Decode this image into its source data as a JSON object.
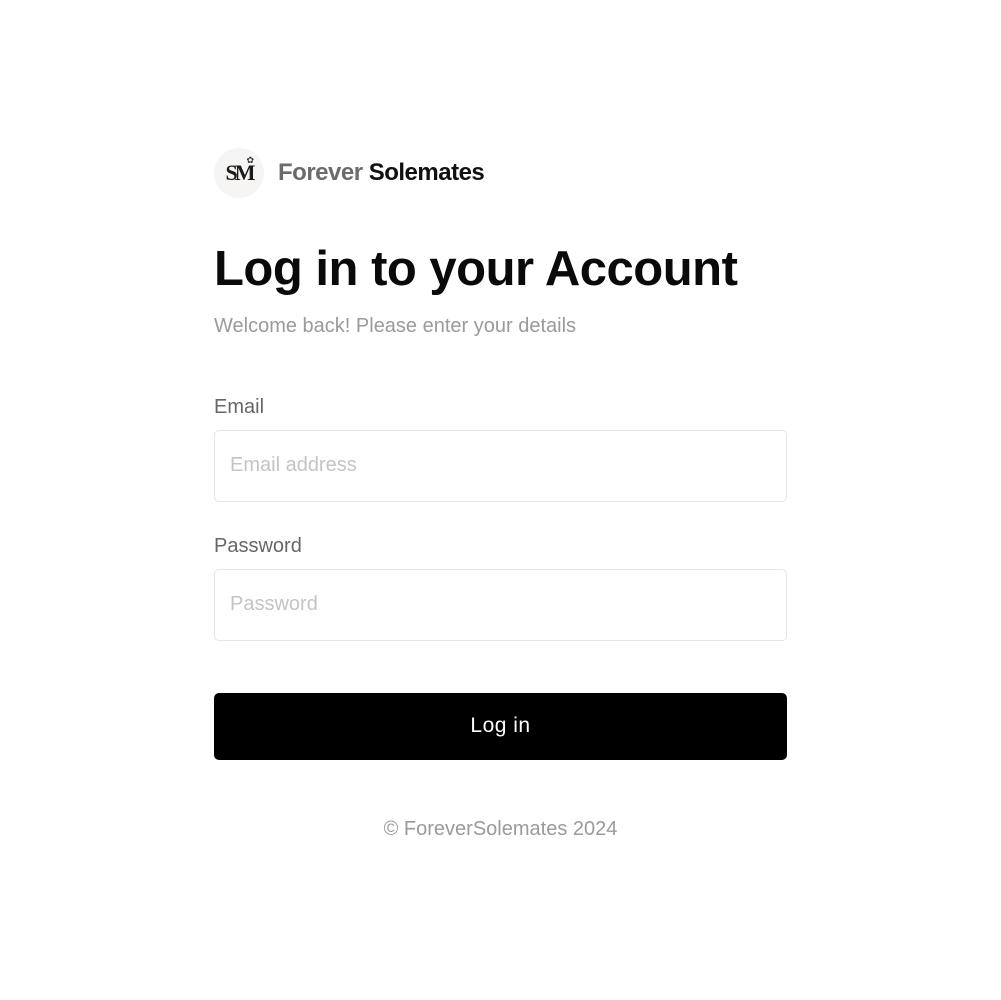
{
  "brand": {
    "logo_text": "SM",
    "name_first": "Forever",
    "name_second": "Solemates"
  },
  "login": {
    "title": "Log in to your Account",
    "subtitle": "Welcome back! Please enter your details",
    "email_label": "Email",
    "email_placeholder": "Email address",
    "email_value": "",
    "password_label": "Password",
    "password_placeholder": "Password",
    "password_value": "",
    "submit_label": "Log in"
  },
  "footer": {
    "copyright": "© ForeverSolemates 2024"
  },
  "colors": {
    "button_bg": "#000000",
    "button_text": "#ffffff",
    "muted_text": "#9a9a9a",
    "label_text": "#666666"
  }
}
